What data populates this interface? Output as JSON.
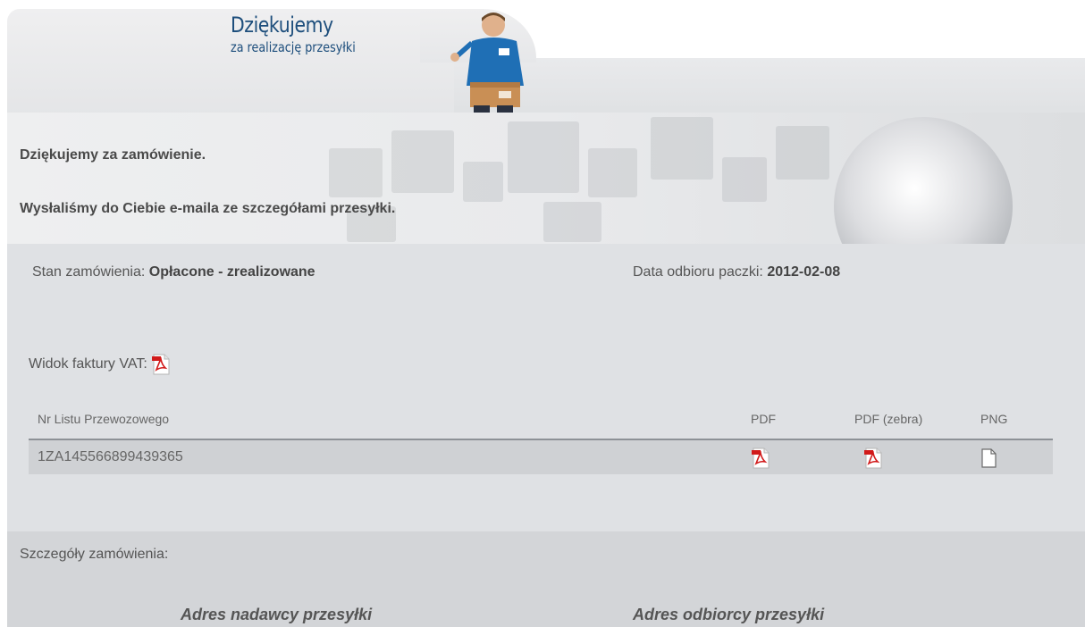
{
  "header": {
    "title": "Dziękujemy",
    "subtitle": "za realizację przesyłki"
  },
  "banner": {
    "line1": "Dziękujemy za zamówienie.",
    "line2": "Wysłaliśmy do Ciebie e-maila ze szczegółami przesyłki."
  },
  "order": {
    "status_label": "Stan zamówienia:",
    "status_value": "Opłacone - zrealizowane",
    "pickup_label": "Data odbioru paczki:",
    "pickup_value": "2012-02-08",
    "invoice_label": "Widok faktury VAT:"
  },
  "table": {
    "headers": [
      "Nr Listu Przewozowego",
      "PDF",
      "PDF (zebra)",
      "PNG"
    ],
    "rows": [
      {
        "number": "1ZA145566899439365"
      }
    ]
  },
  "details": {
    "title": "Szczegóły zamówienia:",
    "sender_heading": "Adres nadawcy przesyłki",
    "recipient_heading": "Adres odbiorcy przesyłki"
  },
  "colors": {
    "title_blue": "#1d4e7c",
    "pdf_red": "#d11a1a"
  },
  "icons": [
    "pdf-icon",
    "png-file-icon"
  ]
}
